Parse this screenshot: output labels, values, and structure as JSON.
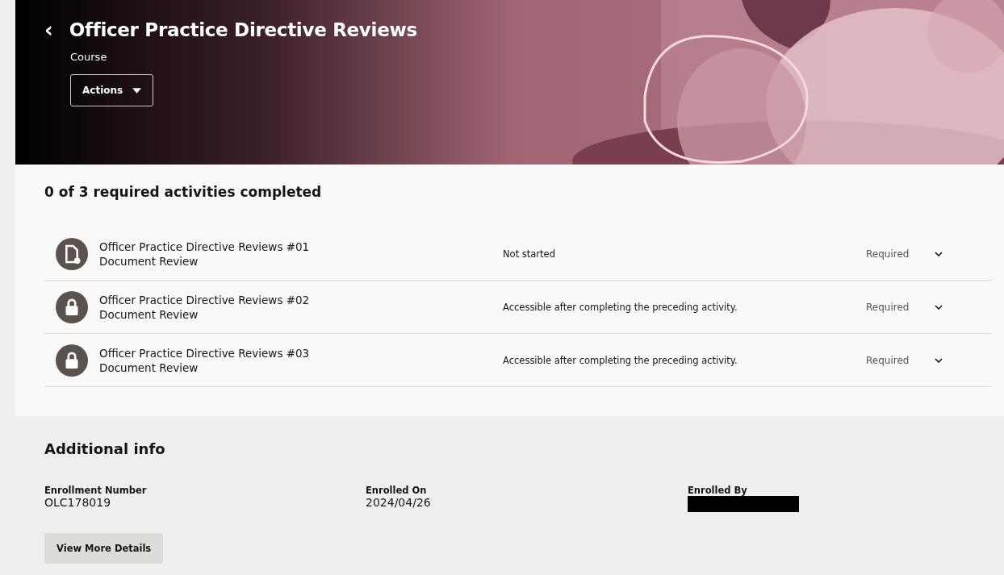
{
  "header": {
    "back": "‹",
    "title": "Officer Practice Directive Reviews",
    "subtitle": "Course",
    "actions_button": "Actions"
  },
  "progress": {
    "summary": "0 of 3 required activities completed"
  },
  "activities": [
    {
      "kind": "document",
      "title": "Officer Practice Directive Reviews #01",
      "type": "Document Review",
      "status": "Not started",
      "requirement": "Required"
    },
    {
      "kind": "locked",
      "title": "Officer Practice Directive Reviews #02",
      "type": "Document Review",
      "status": "Accessible after completing the preceding activity.",
      "requirement": "Required"
    },
    {
      "kind": "locked",
      "title": "Officer Practice Directive Reviews #03",
      "type": "Document Review",
      "status": "Accessible after completing the preceding activity.",
      "requirement": "Required"
    }
  ],
  "additional_info": {
    "heading": "Additional info",
    "fields": [
      {
        "label": "Enrollment Number",
        "value": "OLC178019"
      },
      {
        "label": "Enrolled On",
        "value": "2024/04/26"
      },
      {
        "label": "Enrolled By",
        "redacted": true
      }
    ],
    "button": "View More Details"
  }
}
